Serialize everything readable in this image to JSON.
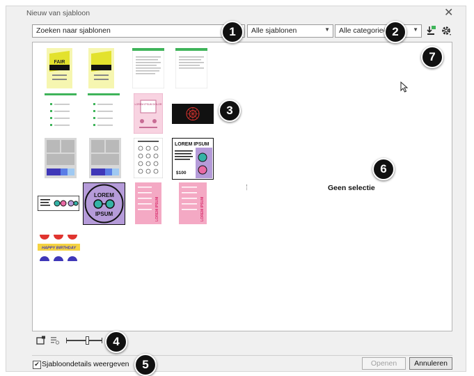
{
  "dialog": {
    "title": "Nieuw van sjabloon",
    "close_icon": "close-icon"
  },
  "toolbar": {
    "search_value": "Zoeken naar sjablonen",
    "templates_filter": "Alle sjablonen",
    "categories_filter": "Alle categorieën",
    "icons": [
      "install-templates-icon",
      "settings-icon"
    ]
  },
  "gallery": {
    "thumbnails": [
      {
        "name": "fair-poster",
        "text": "FAIR"
      },
      {
        "name": "fair-poster-2",
        "text": ""
      },
      {
        "name": "letter-1",
        "text": ""
      },
      {
        "name": "letter-2",
        "text": ""
      },
      {
        "name": "newsletter-1",
        "text": ""
      },
      {
        "name": "newsletter-2",
        "text": ""
      },
      {
        "name": "pink-flyer",
        "text": "LOREM IPSUM DOLOR"
      },
      {
        "name": "dark-banner",
        "text": ""
      },
      {
        "name": "photo-collage-1",
        "text": ""
      },
      {
        "name": "photo-collage-2",
        "text": ""
      },
      {
        "name": "icon-sheet",
        "text": ""
      },
      {
        "name": "sunglasses-ad",
        "text": "LOREM IPSUM",
        "price": "$100"
      },
      {
        "name": "sunglasses-banner",
        "text": ""
      },
      {
        "name": "sunglasses-circle",
        "top": "LOREM",
        "bottom": "IPSUM"
      },
      {
        "name": "pink-menu-1",
        "text": "LOREM IPSUM"
      },
      {
        "name": "pink-menu-2",
        "text": "LOREM IPSUM"
      },
      {
        "name": "birthday-banner",
        "text": "HAPPY BIRTHDAY"
      }
    ]
  },
  "details": {
    "no_selection": "Geen selectie"
  },
  "footer": {
    "view_icons": [
      "view-large-icon",
      "view-details-icon"
    ],
    "zoom_fraction": 0.6,
    "show_details_checked": true,
    "show_details_label": "Sjabloondetails weergeven",
    "open_label": "Openen",
    "cancel_label": "Annuleren"
  },
  "callouts": [
    "1",
    "2",
    "3",
    "4",
    "5",
    "6",
    "7"
  ],
  "colors": {
    "yellow": "#e3e22d",
    "green": "#3fb45a",
    "pink": "#f4a9c4",
    "teal": "#34b3a6",
    "purple": "#b59bd9",
    "navy": "#1f2d4f"
  }
}
